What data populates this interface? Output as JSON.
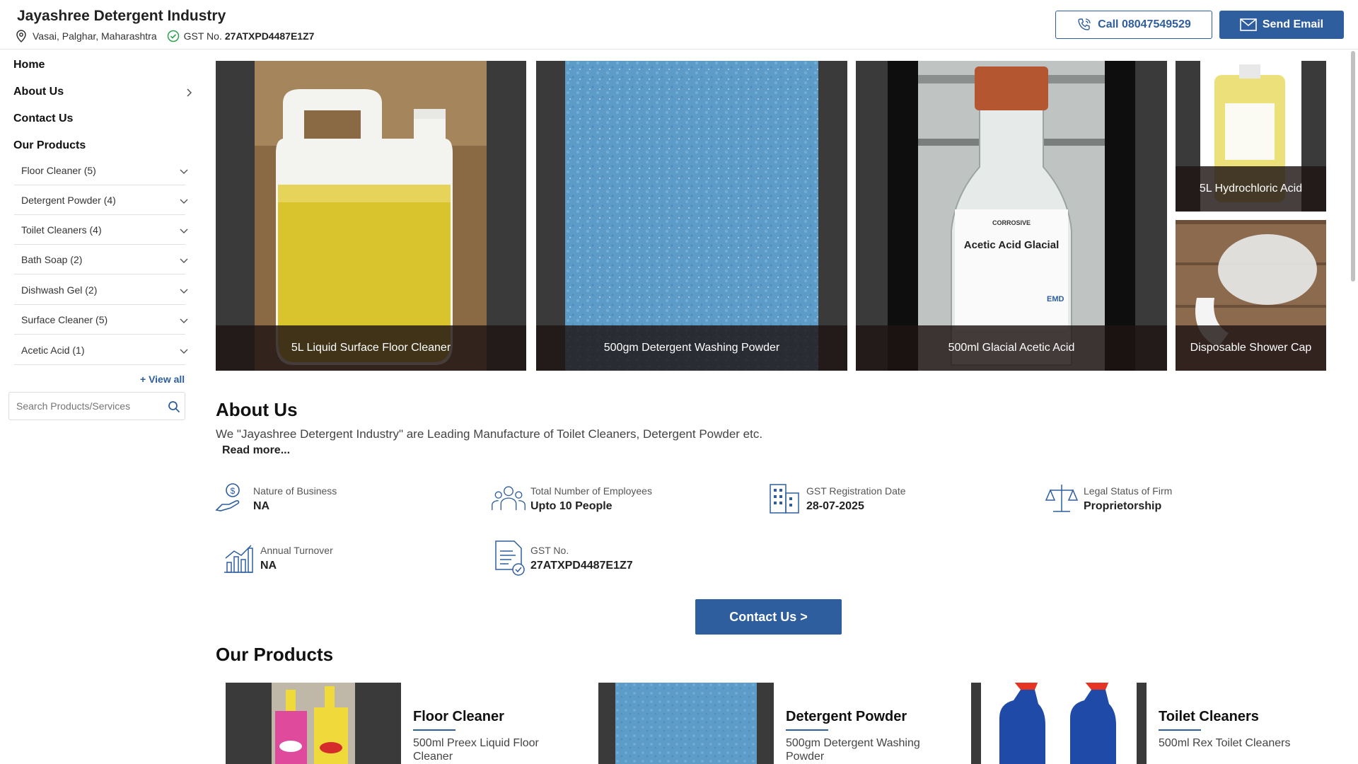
{
  "header": {
    "company_name": "Jayashree Detergent Industry",
    "location": "Vasai, Palghar, Maharashtra",
    "gst_label": "GST No.",
    "gst_value": "27ATXPD4487E1Z7",
    "call_label": "Call 08047549529",
    "email_label": "Send Email"
  },
  "nav": {
    "home": "Home",
    "about": "About Us",
    "contact": "Contact Us",
    "products": "Our Products"
  },
  "categories": [
    "Floor Cleaner (5)",
    "Detergent Powder (4)",
    "Toilet Cleaners (4)",
    "Bath Soap (2)",
    "Dishwash Gel (2)",
    "Surface Cleaner (5)",
    "Acetic Acid (1)"
  ],
  "view_all": "+ View all",
  "search": {
    "placeholder": "Search Products/Services"
  },
  "gallery": [
    "5L Liquid Surface Floor Cleaner",
    "500gm Detergent Washing Powder",
    "500ml Glacial Acetic Acid",
    "5L Hydrochloric Acid",
    "Disposable Shower Cap"
  ],
  "bottle_label": {
    "warn": "CORROSIVE",
    "title": "Acetic Acid Glacial",
    "brand": "EMD"
  },
  "about": {
    "title": "About Us",
    "text": "We \"Jayashree Detergent Industry\" are Leading Manufacture of Toilet Cleaners, Detergent Powder etc.",
    "read_more": "Read more..."
  },
  "facts": [
    {
      "label": "Nature of Business",
      "value": "NA",
      "icon": "money-hand-icon"
    },
    {
      "label": "Total Number of Employees",
      "value": "Upto 10 People",
      "icon": "people-icon"
    },
    {
      "label": "GST Registration Date",
      "value": "28-07-2025",
      "icon": "building-icon"
    },
    {
      "label": "Legal Status of Firm",
      "value": "Proprietorship",
      "icon": "scales-icon"
    },
    {
      "label": "Annual Turnover",
      "value": "NA",
      "icon": "chart-icon"
    },
    {
      "label": "GST No.",
      "value": "27ATXPD4487E1Z7",
      "icon": "document-icon"
    }
  ],
  "contact_button": "Contact Us >",
  "products": {
    "title": "Our Products",
    "items": [
      {
        "name": "Floor Cleaner",
        "sub": "500ml Preex Liquid Floor Cleaner"
      },
      {
        "name": "Detergent Powder",
        "sub": "500gm Detergent Washing Powder"
      },
      {
        "name": "Toilet Cleaners",
        "sub": "500ml Rex Toilet Cleaners"
      }
    ]
  },
  "colors": {
    "accent": "#2e5e9e",
    "caption_bg": "#2a1c1c"
  }
}
